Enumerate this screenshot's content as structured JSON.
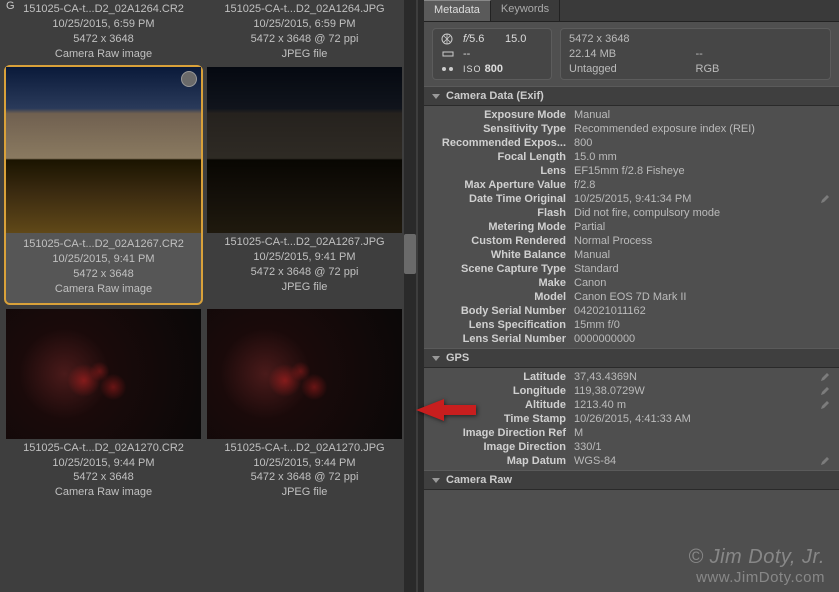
{
  "thumbs": [
    {
      "name": "151025-CA-t...D2_02A1264.CR2",
      "date": "10/25/2015, 6:59 PM",
      "dim": "5472 x 3648",
      "type": "Camera Raw image"
    },
    {
      "name": "151025-CA-t...D2_02A1264.JPG",
      "date": "10/25/2015, 6:59 PM",
      "dim": "5472 x 3648 @ 72 ppi",
      "type": "JPEG file"
    },
    {
      "name": "151025-CA-t...D2_02A1267.CR2",
      "date": "10/25/2015, 9:41 PM",
      "dim": "5472 x 3648",
      "type": "Camera Raw image"
    },
    {
      "name": "151025-CA-t...D2_02A1267.JPG",
      "date": "10/25/2015, 9:41 PM",
      "dim": "5472 x 3648 @ 72 ppi",
      "type": "JPEG file"
    },
    {
      "name": "151025-CA-t...D2_02A1270.CR2",
      "date": "10/25/2015, 9:44 PM",
      "dim": "5472 x 3648",
      "type": "Camera Raw image"
    },
    {
      "name": "151025-CA-t...D2_02A1270.JPG",
      "date": "10/25/2015, 9:44 PM",
      "dim": "5472 x 3648 @ 72 ppi",
      "type": "JPEG file"
    }
  ],
  "gridLetter": "G",
  "tabs": {
    "metadata": "Metadata",
    "keywords": "Keywords"
  },
  "summary": {
    "aperture": "5.6",
    "shutter": "15.0",
    "ev": "--",
    "iso": "800",
    "isoLabel": "ISO",
    "dims": "5472 x 3648",
    "size": "22.14 MB",
    "dash": "--",
    "tag": "Untagged",
    "color": "RGB",
    "fPrefix": "f/"
  },
  "sections": {
    "exif": {
      "title": "Camera Data (Exif)",
      "rows": [
        {
          "l": "Exposure Mode",
          "v": "Manual"
        },
        {
          "l": "Sensitivity Type",
          "v": "Recommended exposure index (REI)"
        },
        {
          "l": "Recommended Expos...",
          "v": "800"
        },
        {
          "l": "Focal Length",
          "v": "15.0 mm"
        },
        {
          "l": "Lens",
          "v": "EF15mm f/2.8 Fisheye"
        },
        {
          "l": "Max Aperture Value",
          "v": "f/2.8"
        },
        {
          "l": "Date Time Original",
          "v": "10/25/2015, 9:41:34 PM",
          "edit": true
        },
        {
          "l": "Flash",
          "v": "Did not fire, compulsory mode"
        },
        {
          "l": "Metering Mode",
          "v": "Partial"
        },
        {
          "l": "Custom Rendered",
          "v": "Normal Process"
        },
        {
          "l": "White Balance",
          "v": "Manual"
        },
        {
          "l": "Scene Capture Type",
          "v": "Standard"
        },
        {
          "l": "Make",
          "v": "Canon"
        },
        {
          "l": "Model",
          "v": "Canon EOS 7D Mark II"
        },
        {
          "l": "Body Serial Number",
          "v": "042021011162"
        },
        {
          "l": "Lens Specification",
          "v": "15mm f/0"
        },
        {
          "l": "Lens Serial Number",
          "v": "0000000000"
        }
      ]
    },
    "gps": {
      "title": "GPS",
      "rows": [
        {
          "l": "Latitude",
          "v": "37,43.4369N",
          "edit": true
        },
        {
          "l": "Longitude",
          "v": "119,38.0729W",
          "edit": true
        },
        {
          "l": "Altitude",
          "v": "1213.40 m",
          "edit": true
        },
        {
          "l": "Time Stamp",
          "v": "10/26/2015, 4:41:33 AM"
        },
        {
          "l": "Image Direction Ref",
          "v": "M"
        },
        {
          "l": "Image Direction",
          "v": "330/1"
        },
        {
          "l": "Map Datum",
          "v": "WGS-84",
          "edit": true
        }
      ]
    },
    "raw": {
      "title": "Camera Raw"
    }
  },
  "watermark": {
    "line1": "© Jim Doty, Jr.",
    "line2": "www.JimDoty.com"
  }
}
